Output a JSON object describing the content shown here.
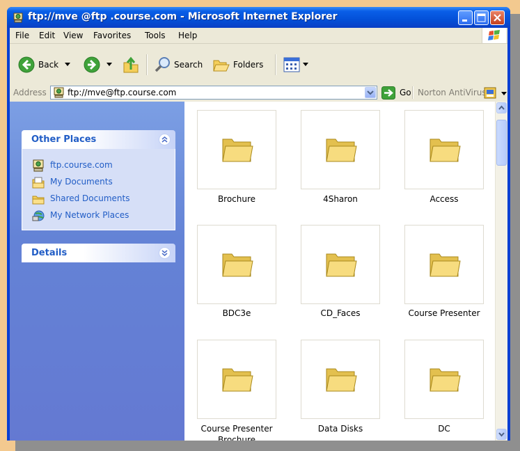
{
  "window": {
    "title": "ftp://mve @ftp .course.com - Microsoft Internet Explorer"
  },
  "menu": [
    "File",
    "Edit",
    "View",
    "Favorites",
    "Tools",
    "Help"
  ],
  "toolbar": {
    "back_label": "Back",
    "search_label": "Search",
    "folders_label": "Folders"
  },
  "address": {
    "label": "Address",
    "value": "ftp://mve@ftp.course.com",
    "go_label": "Go",
    "norton_label": "Norton AntiVirus"
  },
  "other_places": {
    "title": "Other Places",
    "items": [
      {
        "label": "ftp.course.com",
        "icon": "ftp-server-icon"
      },
      {
        "label": "My Documents",
        "icon": "my-documents-icon"
      },
      {
        "label": "Shared Documents",
        "icon": "shared-folder-icon"
      },
      {
        "label": "My Network Places",
        "icon": "network-places-icon"
      }
    ]
  },
  "details": {
    "title": "Details"
  },
  "folders": [
    {
      "name": "Brochure"
    },
    {
      "name": "4Sharon"
    },
    {
      "name": "Access"
    },
    {
      "name": "BDC3e"
    },
    {
      "name": "CD_Faces"
    },
    {
      "name": "Course Presenter"
    },
    {
      "name": "Course Presenter Brochure"
    },
    {
      "name": "Data Disks"
    },
    {
      "name": "DC"
    }
  ],
  "colors": {
    "title_bar": "#0350d8",
    "task_pane": "#6483d6",
    "link_blue": "#215dc6",
    "folder_yellow": "#f6d873"
  }
}
